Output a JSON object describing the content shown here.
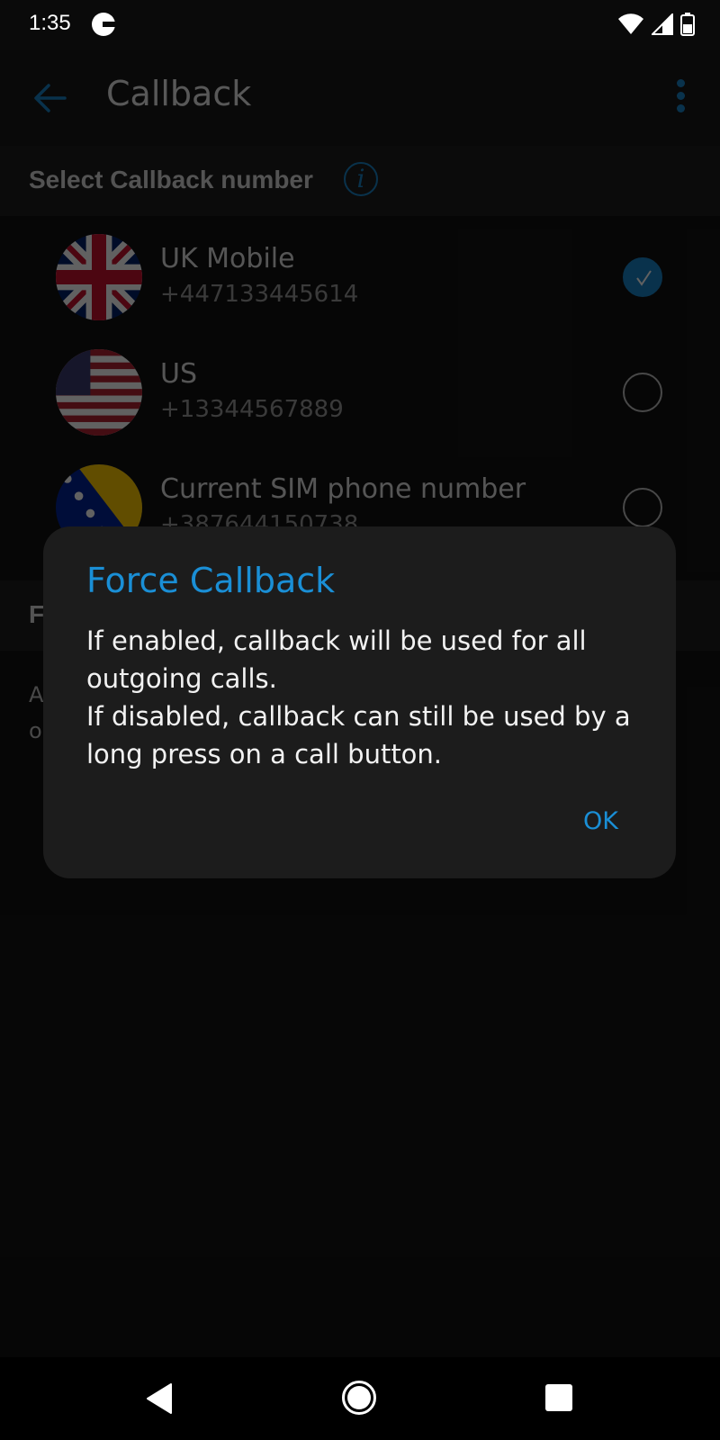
{
  "status_bar": {
    "time": "1:35",
    "icons": [
      "google-icon",
      "wifi-icon",
      "cell-signal-icon",
      "battery-icon"
    ]
  },
  "app_bar": {
    "title": "Callback",
    "back_icon": "arrow-left-icon",
    "menu_icon": "more-vert-icon"
  },
  "callback_section": {
    "title": "Select Callback number",
    "info_icon": "info-icon",
    "info_glyph": "i",
    "options": [
      {
        "name": "UK Mobile",
        "number": "+447133445614",
        "flag": "uk-flag",
        "selected": true
      },
      {
        "name": "US",
        "number": "+13344567889",
        "flag": "us-flag",
        "selected": false
      },
      {
        "name": "Current SIM phone number",
        "number": "+387644150738",
        "flag": "bosnia-flag",
        "selected": false
      }
    ]
  },
  "force_section": {
    "title_visible": "F",
    "desc_visible_lines": [
      "A",
      "o"
    ]
  },
  "dialog": {
    "title": "Force Callback",
    "body_line1": "If enabled, callback will be used for all outgoing calls.",
    "body_line2": "If disabled, callback can still be used by a long press on a call button.",
    "ok_label": "OK"
  },
  "nav_bar": {
    "buttons": [
      "back-icon",
      "home-icon",
      "recents-icon"
    ]
  },
  "colors": {
    "accent": "#1a8fd6",
    "dialog_bg": "#1c1c1c",
    "scrim": "#000000"
  }
}
